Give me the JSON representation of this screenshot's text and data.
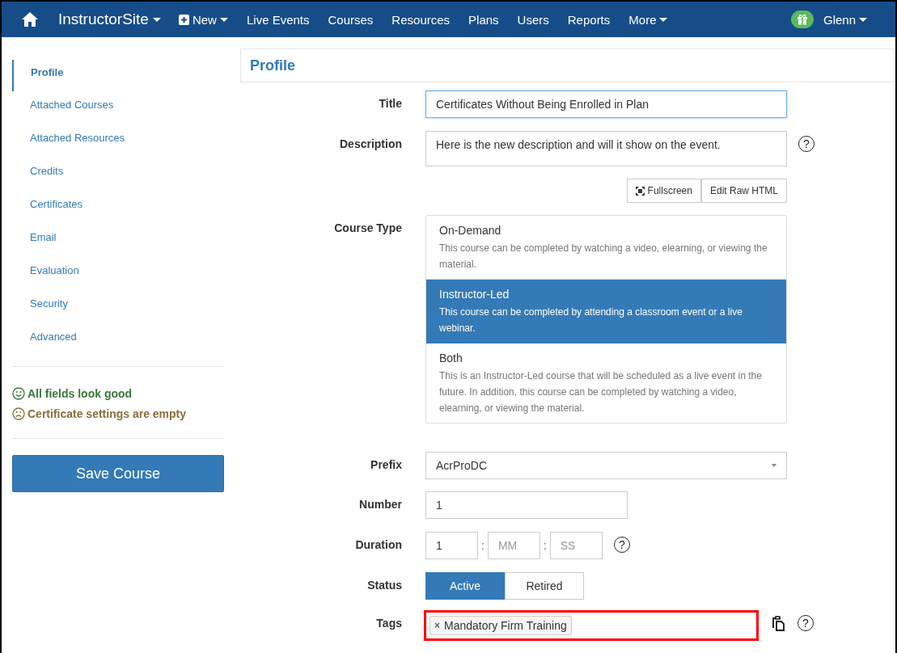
{
  "nav": {
    "brand": "InstructorSite",
    "new_label": "New",
    "items": [
      {
        "label": "Live Events",
        "dropdown": false
      },
      {
        "label": "Courses",
        "dropdown": false
      },
      {
        "label": "Resources",
        "dropdown": false
      },
      {
        "label": "Plans",
        "dropdown": false
      },
      {
        "label": "Users",
        "dropdown": false
      },
      {
        "label": "Reports",
        "dropdown": false
      },
      {
        "label": "More",
        "dropdown": true
      }
    ],
    "user": "Glenn"
  },
  "sidebar": {
    "items": [
      {
        "label": "Profile",
        "selected": true
      },
      {
        "label": "Attached Courses",
        "selected": false
      },
      {
        "label": "Attached Resources",
        "selected": false
      },
      {
        "label": "Credits",
        "selected": false
      },
      {
        "label": "Certificates",
        "selected": false
      },
      {
        "label": "Email",
        "selected": false
      },
      {
        "label": "Evaluation",
        "selected": false
      },
      {
        "label": "Security",
        "selected": false
      },
      {
        "label": "Advanced",
        "selected": false
      }
    ],
    "messages": [
      {
        "kind": "ok",
        "text": "All fields look good"
      },
      {
        "kind": "warn",
        "text": "Certificate settings are empty"
      }
    ],
    "save_button": "Save Course"
  },
  "panel_title": "Profile",
  "form": {
    "title": {
      "label": "Title",
      "value": "Certificates Without Being Enrolled in Plan"
    },
    "description": {
      "label": "Description",
      "value": "Here is the new description and will it show on the event.",
      "help": "?",
      "buttons": [
        "Fullscreen",
        "Edit Raw HTML"
      ]
    },
    "course_type": {
      "label": "Course Type",
      "options": [
        {
          "name": "On-Demand",
          "text": "This course can be completed by watching a video, elearning, or viewing the material.",
          "selected": false
        },
        {
          "name": "Instructor-Led",
          "text": "This course can be completed by attending a classroom event or a live webinar.",
          "selected": true
        },
        {
          "name": "Both",
          "text": "This is an Instructor-Led course that will be scheduled as a live event in the future. In addition, this course can be completed by watching a video, elearning, or viewing the material.",
          "selected": false
        }
      ]
    },
    "prefix": {
      "label": "Prefix",
      "value": "AcrProDC"
    },
    "number": {
      "label": "Number",
      "value": "1"
    },
    "duration": {
      "label": "Duration",
      "fields": [
        {
          "value": "1"
        },
        {
          "placeholder": "MM"
        },
        {
          "placeholder": "SS"
        }
      ],
      "separator": ":",
      "help": "?"
    },
    "status": {
      "label": "Status",
      "options": [
        {
          "label": "Active",
          "selected": true
        },
        {
          "label": "Retired",
          "selected": false
        }
      ]
    },
    "tags": {
      "label": "Tags",
      "tags": [
        {
          "remove": "×",
          "label": "Mandatory Firm Training"
        }
      ],
      "highlighted": true,
      "help": "?"
    }
  }
}
